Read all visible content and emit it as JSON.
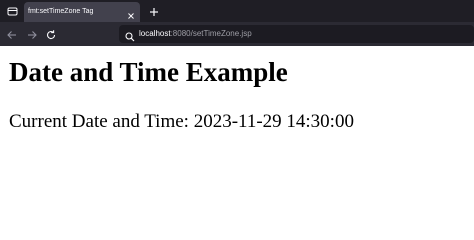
{
  "browser": {
    "tab": {
      "title": "fmt:setTimeZone Tag",
      "close_icon": "close-icon"
    },
    "new_tab_icon": "plus-icon",
    "nav": {
      "back_icon": "arrow-left-icon",
      "forward_icon": "arrow-right-icon",
      "reload_icon": "reload-icon"
    },
    "urlbar": {
      "icon": "search-icon",
      "host": "localhost",
      "rest": ":8080/setTimeZone.jsp"
    },
    "colors": {
      "tabstrip": "#1f1e25",
      "tab_active": "#42414d",
      "navbar": "#2b2a33",
      "urlbar": "#1c1b22"
    }
  },
  "page": {
    "heading": "Date and Time Example",
    "line": "Current Date and Time: 2023-11-29 14:30:00"
  }
}
